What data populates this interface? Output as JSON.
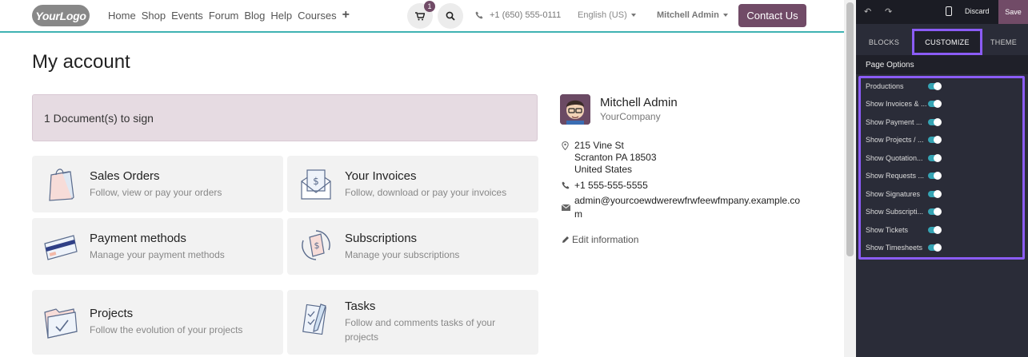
{
  "navbar": {
    "logo_text": "YourLogo",
    "links": [
      "Home",
      "Shop",
      "Events",
      "Forum",
      "Blog",
      "Help",
      "Courses"
    ],
    "add_icon": "+",
    "cart_count": "1",
    "phone": "+1 (650) 555-0111",
    "language": "English (US)",
    "user": "Mitchell Admin",
    "contact_label": "Contact Us"
  },
  "main": {
    "title": "My account",
    "alert": "1  Document(s) to sign",
    "cards": [
      {
        "title": "Sales Orders",
        "desc": "Follow, view or pay your orders"
      },
      {
        "title": "Your Invoices",
        "desc": "Follow, download or pay your invoices"
      },
      {
        "title": "Payment methods",
        "desc": "Manage your payment methods"
      },
      {
        "title": "Subscriptions",
        "desc": "Manage your subscriptions"
      },
      {
        "title": "Projects",
        "desc": "Follow the evolution of your projects"
      },
      {
        "title": "Tasks",
        "desc": "Follow and comments tasks of your projects"
      }
    ]
  },
  "profile": {
    "name": "Mitchell Admin",
    "company": "YourCompany",
    "address_line1": "215 Vine St",
    "address_line2": "Scranton PA 18503",
    "address_line3": "United States",
    "phone": "+1 555-555-5555",
    "email": "admin@yourcoewdwerewfrwfeewfmpany.example.com",
    "edit_label": "Edit information"
  },
  "editor": {
    "discard_label": "Discard",
    "save_label": "Save",
    "tabs": [
      "BLOCKS",
      "CUSTOMIZE",
      "THEME"
    ],
    "active_tab": "CUSTOMIZE",
    "section_title": "Page Options",
    "options": [
      {
        "label": "Productions",
        "on": true
      },
      {
        "label": "Show Invoices & ...",
        "on": true
      },
      {
        "label": "Show Payment ...",
        "on": true
      },
      {
        "label": "Show Projects / ...",
        "on": true
      },
      {
        "label": "Show Quotation...",
        "on": true
      },
      {
        "label": "Show Requests ...",
        "on": true
      },
      {
        "label": "Show Signatures",
        "on": true
      },
      {
        "label": "Show Subscripti...",
        "on": true
      },
      {
        "label": "Show Tickets",
        "on": true
      },
      {
        "label": "Show Timesheets",
        "on": true
      }
    ],
    "accent_color": "#8b5cf6",
    "toggle_color": "#35a4b4"
  },
  "colors": {
    "brand": "#714b67",
    "nav_border": "#3fb2b2",
    "alert_bg": "#e6dbe2"
  }
}
